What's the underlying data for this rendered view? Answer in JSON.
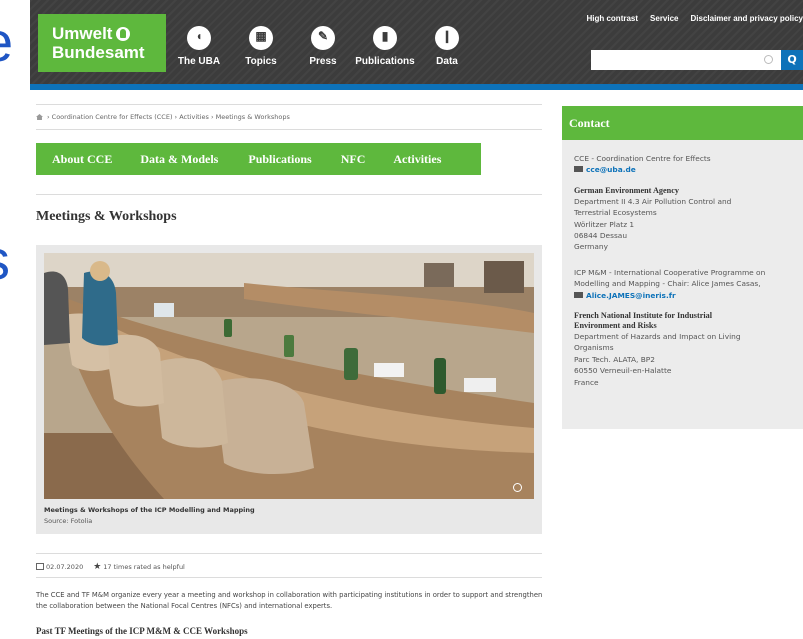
{
  "slide_fragment": {
    "glyph_top": "e",
    "glyph_mid": "s"
  },
  "header": {
    "logo_line1": "Umwelt",
    "logo_line2": "Bundesamt",
    "nav": [
      {
        "label": "The UBA",
        "icon": "uba-icon"
      },
      {
        "label": "Topics",
        "icon": "topics-icon"
      },
      {
        "label": "Press",
        "icon": "press-icon"
      },
      {
        "label": "Publications",
        "icon": "publications-icon"
      },
      {
        "label": "Data",
        "icon": "data-icon"
      }
    ],
    "top_links": [
      "High contrast",
      "Service",
      "Disclaimer and privacy policy"
    ],
    "search": {
      "placeholder": "",
      "button_glyph": "Q"
    }
  },
  "breadcrumb": {
    "text": "› Coordination Centre for Effects (CCE) › Activities › Meetings & Workshops"
  },
  "subnav": [
    {
      "label": "About CCE"
    },
    {
      "label": "Data & Models"
    },
    {
      "label": "Publications"
    },
    {
      "label": "NFC"
    },
    {
      "label": "Activities"
    }
  ],
  "page": {
    "title": "Meetings & Workshops",
    "image_caption": "Meetings & Workshops of the ICP Modelling and Mapping",
    "image_source": "Source: Fotolia",
    "date": "02.07.2020",
    "rating": "17 times rated as helpful",
    "body": "The CCE and TF M&M organize every year a meeting and workshop in collaboration with participating institutions in order to support and strengthen the collaboration between the National Focal Centres (NFCs) and international experts.",
    "section_heading": "Past TF Meetings of the ICP M&M & CCE Workshops"
  },
  "contact": {
    "heading": "Contact",
    "cce_name": "CCE - Coordination Centre for Effects",
    "cce_email": "cce@uba.de",
    "uba_name": "German Environment Agency",
    "uba_address": [
      "Department II 4.3 Air Pollution Control and",
      "Terrestrial Ecosystems",
      "Wörlitzer Platz 1",
      "06844 Dessau",
      "Germany"
    ],
    "icp_text_1": "ICP M&M - International Cooperative Programme on",
    "icp_text_2": "Modelling and Mapping - Chair: Alice James Casas,",
    "icp_email": "Alice.JAMES@ineris.fr",
    "ineris_name_1": "French National Institute for Industrial",
    "ineris_name_2": "Environment and Risks",
    "ineris_address": [
      "Department of Hazards and Impact on Living",
      "Organisms",
      "Parc Tech. ALATA, BP2",
      "60550 Verneuil-en-Halatte",
      "France"
    ]
  },
  "colors": {
    "brand_green": "#5eb83d",
    "header_dark": "#3c3c3c",
    "accent_blue": "#0d72b9"
  }
}
